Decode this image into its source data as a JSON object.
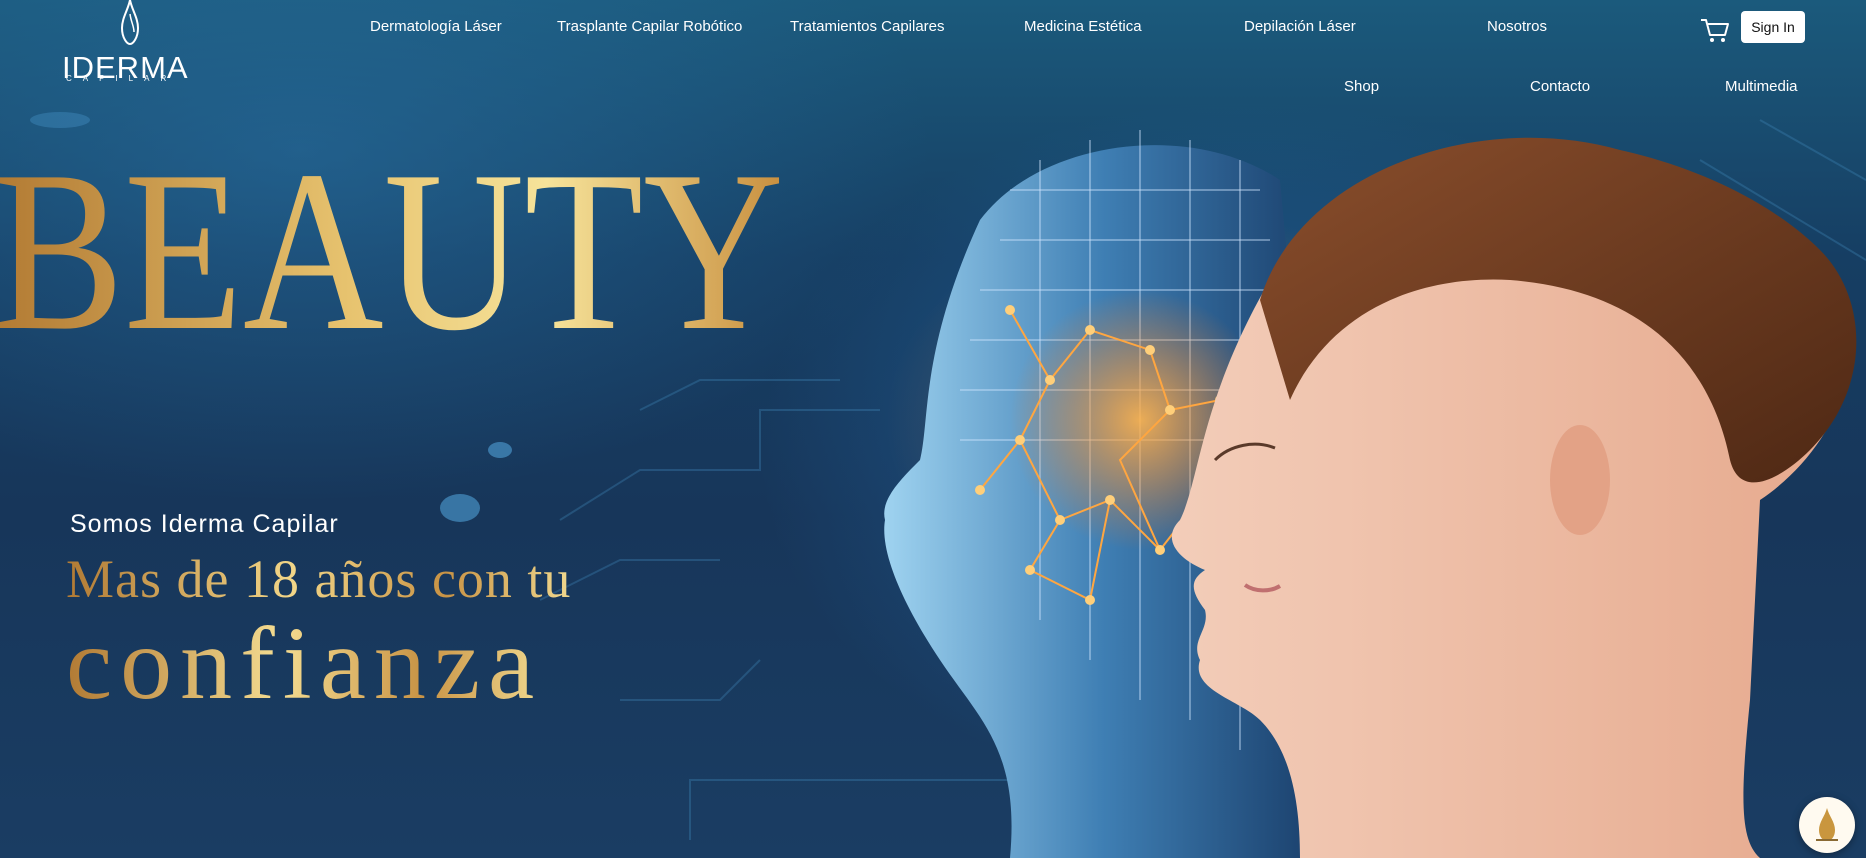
{
  "logo": {
    "word": "IDERMA",
    "sub": "CAPILAR"
  },
  "nav": {
    "row1": [
      "Dermatología Láser",
      "Trasplante Capilar Robótico",
      "Tratamientos Capilares",
      "Medicina Estética",
      "Depilación Láser",
      "Nosotros"
    ],
    "row2": [
      "Shop",
      "Contacto",
      "Multimedia"
    ]
  },
  "actions": {
    "cart_icon": "cart-icon",
    "sign_in": "Sign In"
  },
  "hero": {
    "big_word": "BEAUTY",
    "intro": "Somos Iderma Capilar",
    "line1": "Mas de 18 años con tu",
    "line2": "confianza"
  },
  "colors": {
    "gold_light": "#f2d688",
    "gold_dark": "#b17a34",
    "bg": "#17365a"
  },
  "fab_icon": "iderma-drop-icon"
}
